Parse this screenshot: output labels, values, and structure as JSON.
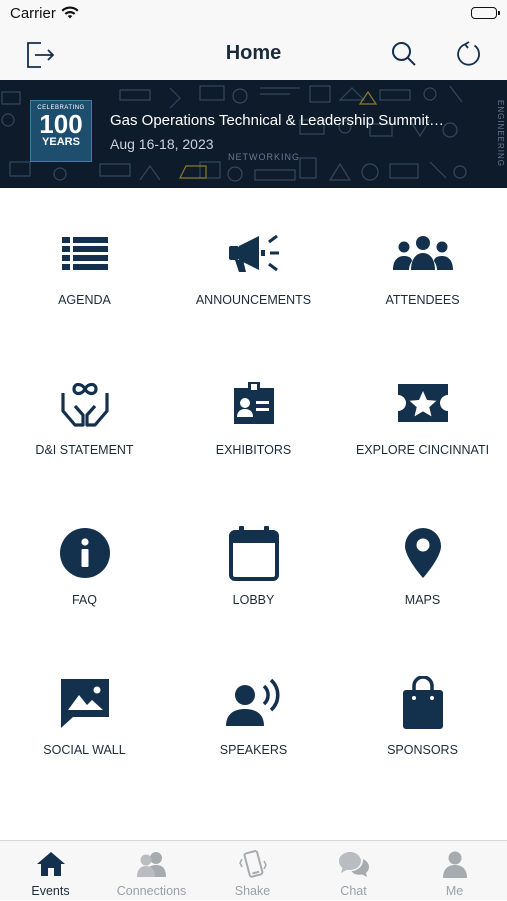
{
  "status_bar": {
    "carrier": "Carrier"
  },
  "nav": {
    "title": "Home",
    "logout_icon": "logout-icon",
    "search_icon": "search-icon",
    "refresh_icon": "refresh-icon"
  },
  "banner": {
    "logo_text": {
      "top": "CELEBRATING",
      "number": "100",
      "bottom": "YEARS"
    },
    "event_title": "Gas Operations Technical & Leadership Summit…",
    "event_dates": "Aug 16-18, 2023",
    "pattern_words": {
      "networking": "NETWORKING",
      "engineering": "ENGINEERING"
    }
  },
  "grid": {
    "items": [
      {
        "label": "AGENDA",
        "icon": "list-icon"
      },
      {
        "label": "ANNOUNCEMENTS",
        "icon": "megaphone-icon"
      },
      {
        "label": "ATTENDEES",
        "icon": "people-icon"
      },
      {
        "label": "D&I STATEMENT",
        "icon": "hands-infinity-icon"
      },
      {
        "label": "EXHIBITORS",
        "icon": "id-badge-icon"
      },
      {
        "label": "EXPLORE CINCINNATI",
        "icon": "ticket-star-icon"
      },
      {
        "label": "FAQ",
        "icon": "info-icon"
      },
      {
        "label": "LOBBY",
        "icon": "calendar-icon"
      },
      {
        "label": "MAPS",
        "icon": "map-pin-icon"
      },
      {
        "label": "SOCIAL WALL",
        "icon": "image-chat-icon"
      },
      {
        "label": "SPEAKERS",
        "icon": "speaker-person-icon"
      },
      {
        "label": "SPONSORS",
        "icon": "shopping-bag-icon"
      }
    ]
  },
  "tabbar": {
    "tabs": [
      {
        "label": "Events",
        "icon": "home-icon",
        "active": true
      },
      {
        "label": "Connections",
        "icon": "connections-icon",
        "active": false
      },
      {
        "label": "Shake",
        "icon": "shake-phone-icon",
        "active": false
      },
      {
        "label": "Chat",
        "icon": "chat-icon",
        "active": false
      },
      {
        "label": "Me",
        "icon": "person-icon",
        "active": false
      }
    ]
  },
  "colors": {
    "icon": "#13304d",
    "banner_bg": "#0e1b2b",
    "tab_inactive": "#9aa0a6",
    "tab_active": "#1c2b3a"
  }
}
